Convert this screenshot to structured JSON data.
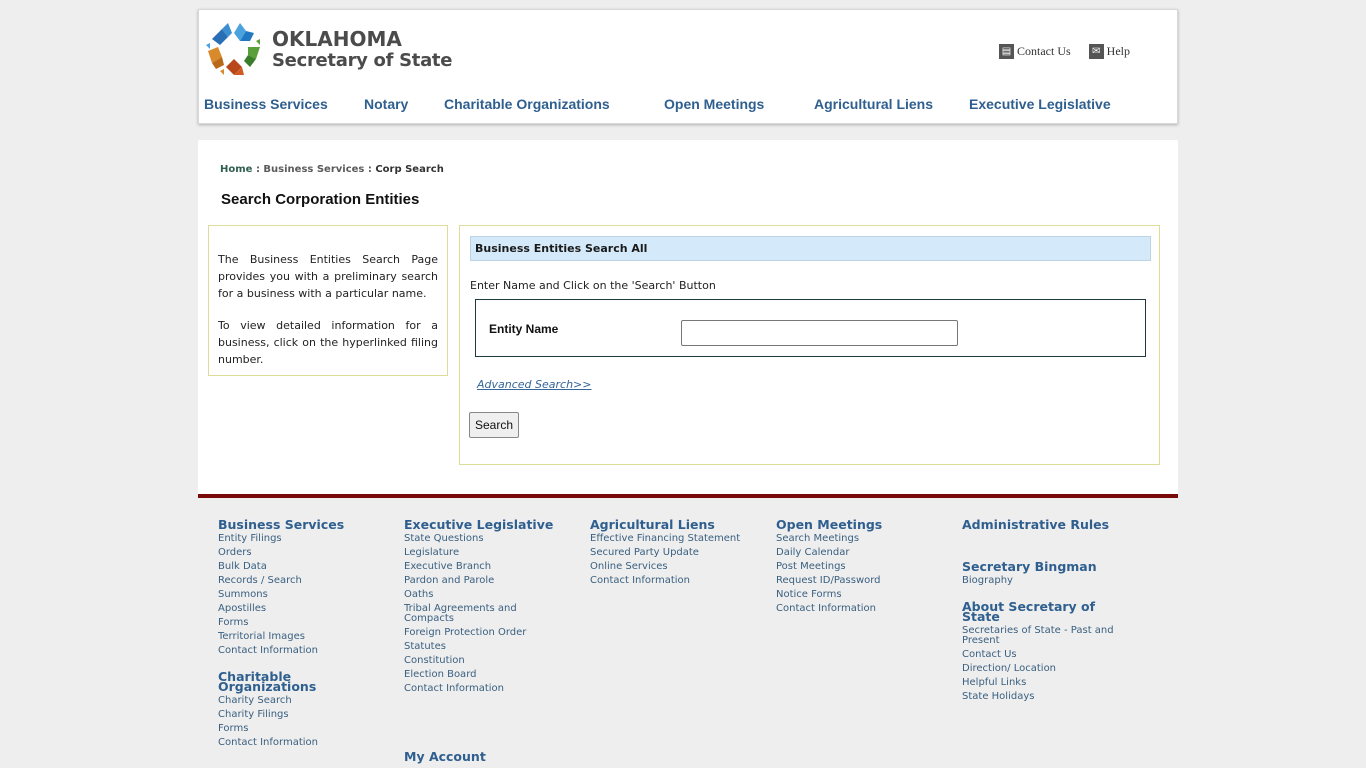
{
  "header": {
    "logo": {
      "line1": "OKLAHOMA",
      "line2": "Secretary of State"
    },
    "util_links": [
      {
        "label": "Contact Us",
        "icon": "contact-form-icon"
      },
      {
        "label": "Help",
        "icon": "envelope-icon"
      }
    ],
    "nav": [
      {
        "label": "Business Services"
      },
      {
        "label": "Notary"
      },
      {
        "label": "Charitable Organizations"
      },
      {
        "label": "Open Meetings"
      },
      {
        "label": "Agricultural Liens"
      },
      {
        "label": "Executive Legislative"
      }
    ]
  },
  "breadcrumb": [
    {
      "label": "Home"
    },
    {
      "label": "Business Services"
    },
    {
      "label": "Corp Search"
    }
  ],
  "breadcrumb_sep": ":",
  "page_title": "Search Corporation Entities",
  "info_box": {
    "p1": "The Business Entities Search Page provides you with a preliminary search for a business with a particular name.",
    "p2": "To view detailed information for a business, click on the hyperlinked filing number."
  },
  "search_panel": {
    "header": "Business Entities Search All",
    "instructions": "Enter Name and Click on the 'Search' Button",
    "field_label": "Entity Name",
    "field_value": "",
    "advanced_link": "Advanced Search>>",
    "search_button": "Search"
  },
  "footer": {
    "columns": [
      {
        "groups": [
          {
            "heading": [
              "Business Services"
            ],
            "links": [
              "Entity Filings",
              "Orders",
              "Bulk Data",
              "Records / Search",
              "Summons",
              "Apostilles",
              "Forms",
              "Territorial Images",
              "Contact Information"
            ]
          },
          {
            "heading": [
              "Charitable",
              "Organizations"
            ],
            "links": [
              "Charity Search",
              "Charity Filings",
              "Forms",
              "Contact Information"
            ]
          }
        ]
      },
      {
        "groups": [
          {
            "heading": [
              "Executive Legislative"
            ],
            "links": [
              "State Questions",
              "Legislature",
              "Executive Branch",
              "Pardon and Parole",
              "Oaths",
              "Tribal Agreements and\nCompacts",
              "Foreign Protection Order",
              "Statutes",
              "Constitution",
              "Election Board",
              "Contact Information"
            ]
          },
          {
            "heading": [
              "My Account"
            ],
            "links": []
          }
        ]
      },
      {
        "groups": [
          {
            "heading": [
              "Agricultural Liens"
            ],
            "links": [
              "Effective Financing Statement",
              "Secured Party Update",
              "Online Services",
              "Contact Information"
            ]
          }
        ]
      },
      {
        "groups": [
          {
            "heading": [
              "Open Meetings"
            ],
            "links": [
              "Search Meetings",
              "Daily Calendar",
              "Post Meetings",
              "Request ID/Password",
              "Notice Forms",
              "Contact Information"
            ]
          }
        ]
      },
      {
        "groups": [
          {
            "heading": [
              "Administrative Rules"
            ],
            "links": []
          },
          {
            "heading": [
              "Secretary Bingman"
            ],
            "links": [
              "Biography"
            ]
          },
          {
            "heading": [
              "About Secretary of",
              "State"
            ],
            "links": [
              "Secretaries of State - Past and\nPresent",
              "Contact Us",
              "Direction/ Location",
              "Helpful Links",
              "State Holidays"
            ]
          }
        ]
      }
    ]
  }
}
